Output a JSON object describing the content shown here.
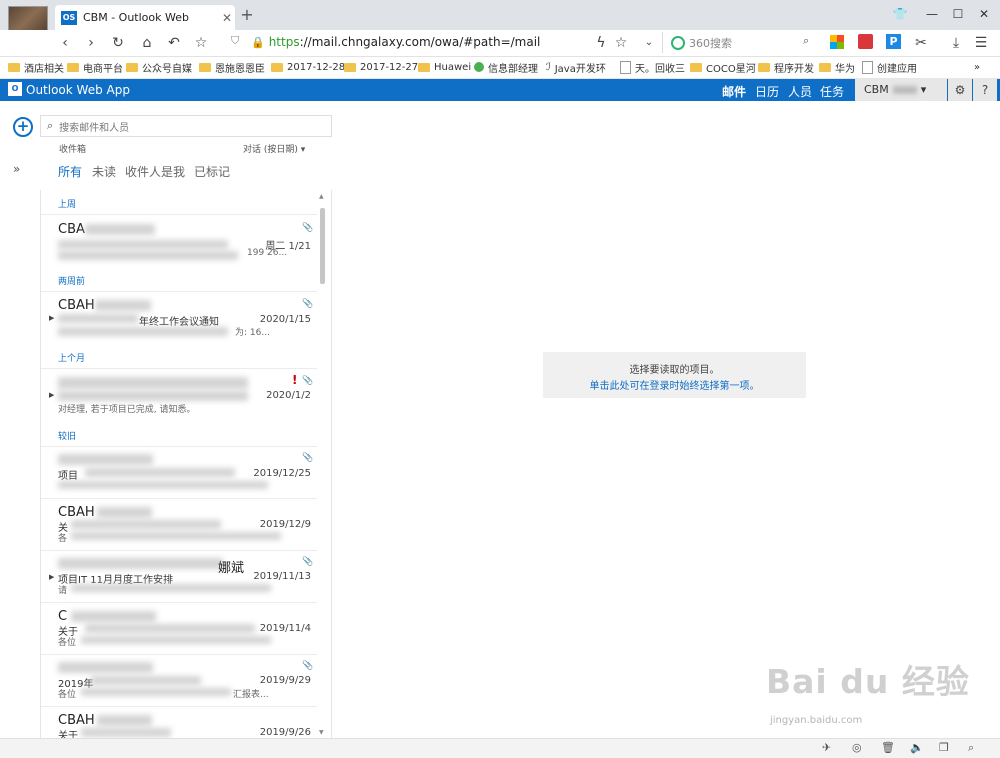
{
  "browser": {
    "tab_title": "CBM  - Outlook Web",
    "tab_favicon": "OS",
    "new_tab": "+",
    "url_https": "https",
    "url_rest": "://mail.chngalaxy.com/owa/#path=/mail",
    "search_engine": "360搜索",
    "bookmarks": [
      "酒店相关",
      "电商平台",
      "公众号自媒",
      "恩施恩恩臣",
      "2017-12-28",
      "2017-12-27",
      "Huawei",
      "信息部经理",
      "Java开发环",
      "天。回收三",
      "COCO星河",
      "程序开发",
      "华为",
      "创建应用"
    ],
    "bookmarks_more": "»"
  },
  "owa": {
    "app_name": "Outlook Web App",
    "nav": [
      "邮件",
      "日历",
      "人员",
      "任务"
    ],
    "user": "CBM",
    "search_placeholder": "搜索邮件和人员",
    "folder": "收件箱",
    "sort": "对话 (按日期)",
    "filters": [
      "所有",
      "未读",
      "收件人是我",
      "已标记"
    ],
    "groups": [
      "上周",
      "两周前",
      "上个月",
      "较旧"
    ],
    "messages": [
      {
        "sender": "CBA",
        "subject": "",
        "preview": "",
        "date": "周二 1/21",
        "extra": "199 26..."
      },
      {
        "sender": "CBAH",
        "subject": "年终工作会议通知",
        "preview": "为: 16...",
        "date": "2020/1/15"
      },
      {
        "sender": "",
        "subject": "",
        "preview": "对经理,  若于项目已完成,  请知悉。",
        "date": "2020/1/2"
      },
      {
        "sender": "",
        "subject": "项目",
        "preview": "",
        "date": "2019/12/25"
      },
      {
        "sender": "CBAH",
        "subject": "关",
        "preview": "各",
        "date": "2019/12/9"
      },
      {
        "sender": "",
        "subject": "项目IT 11月月度工作安排",
        "preview": "请",
        "date": "2019/11/13",
        "sender_tail": "娜斌"
      },
      {
        "sender": "C",
        "subject": "关于",
        "preview": "各位",
        "date": "2019/11/4"
      },
      {
        "sender": "",
        "subject": "2019年",
        "preview": "各位",
        "date": "2019/9/29",
        "preview_tail": "汇报表..."
      },
      {
        "sender": "CBAH",
        "subject": "关于",
        "preview": "",
        "date": "2019/9/26"
      }
    ],
    "reading_main": "选择要读取的项目。",
    "reading_link": "单击此处可在登录时始终选择第一项。"
  },
  "watermark": {
    "logo": "Bai du 经验",
    "url": "jingyan.baidu.com"
  }
}
